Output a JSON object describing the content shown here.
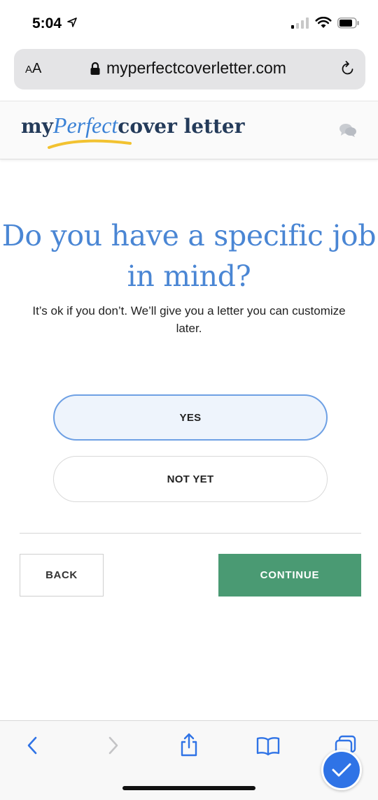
{
  "status_bar": {
    "time": "5:04"
  },
  "browser": {
    "text_size_label_small": "A",
    "text_size_label_large": "A",
    "url": "myperfectcoverletter.com"
  },
  "site": {
    "logo_my": "my",
    "logo_perfect": "Perfect",
    "logo_cover": "cover letter"
  },
  "main": {
    "question": "Do you have a specific job in mind?",
    "subtitle": "It’s ok if you don’t. We’ll give you a letter you can customize later.",
    "options": [
      {
        "label": "YES",
        "selected": true
      },
      {
        "label": "NOT YET",
        "selected": false
      }
    ],
    "back_label": "BACK",
    "continue_label": "CONTINUE"
  },
  "colors": {
    "accent_blue": "#4a86d4",
    "continue_green": "#4a9a73",
    "selected_option_bg": "#eef4fc",
    "badge_blue": "#2f73e6"
  },
  "icons": {
    "status": [
      "location-arrow-icon",
      "signal-icon",
      "wifi-icon",
      "battery-icon"
    ],
    "browser": [
      "lock-icon",
      "reload-icon"
    ],
    "header": [
      "chat-icon"
    ],
    "toolbar": [
      "back-arrow-icon",
      "forward-arrow-icon",
      "share-icon",
      "bookmarks-icon",
      "tabs-icon"
    ],
    "overlay": [
      "checkmark-icon"
    ]
  }
}
